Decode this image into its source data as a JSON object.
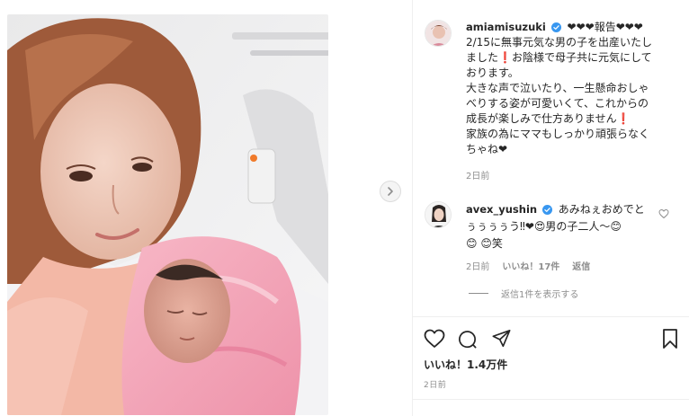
{
  "post": {
    "author": "amiamisuzuki",
    "caption_lines": [
      "❤❤❤報告❤❤❤",
      "2/15に無事元気な男の子を出産いたし",
      "ました❗お陰様で母子共に元気にして",
      "おります。",
      "大きな声で泣いたり、一生懸命おしゃ",
      "べりする姿が可愛いくて、これからの",
      "成長が楽しみで仕方ありません❗",
      "家族の為にママもしっかり頑張らなく",
      "ちゃね❤"
    ],
    "caption_time": "2日前",
    "likes": "いいね！1.4万件",
    "post_time": "2日前"
  },
  "comment": {
    "author": "avex_yushin",
    "lines": [
      "あみねぇおめでと",
      "ぅぅぅぅう‼❤😍男の子二人〜😊",
      "😊 😊笑"
    ],
    "time": "2日前",
    "likes": "いいね！17件",
    "reply": "返信",
    "view_replies": "返信1件を表示する"
  },
  "icons": {
    "verified": "verified-badge-icon",
    "next": "chevron-right-icon",
    "heart": "heart-icon",
    "comment": "comment-bubble-icon",
    "share": "paper-plane-icon",
    "save": "bookmark-icon"
  },
  "colors": {
    "verified": "#3897f0",
    "text": "#262626",
    "muted": "#8e8e8e",
    "border": "#efefef"
  }
}
